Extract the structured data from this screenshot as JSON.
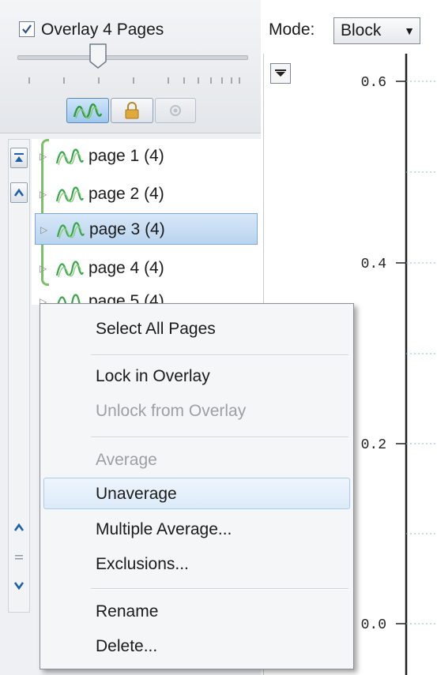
{
  "overlay": {
    "label": "Overlay 4 Pages",
    "checked": true
  },
  "toolbar": {
    "icons": [
      "wave-icon",
      "lock-icon",
      "circle-icon"
    ]
  },
  "mode": {
    "label": "Mode:",
    "value": "Block"
  },
  "pages": [
    {
      "label": "page 1 (4)",
      "selected": false
    },
    {
      "label": "page 2 (4)",
      "selected": false
    },
    {
      "label": "page 3 (4)",
      "selected": true
    },
    {
      "label": "page 4 (4)",
      "selected": false
    },
    {
      "label": "page 5 (4)",
      "selected": false
    }
  ],
  "context_menu": {
    "select_all": "Select All Pages",
    "lock_in_overlay": "Lock in Overlay",
    "unlock_from_overlay": "Unlock from Overlay",
    "average": "Average",
    "unaverage": "Unaverage",
    "multiple_average": "Multiple Average...",
    "exclusions": "Exclusions...",
    "rename": "Rename",
    "delete": "Delete..."
  },
  "chart": {
    "y_ticks": [
      "0.6",
      "0.4",
      "0.2",
      "0.0"
    ]
  },
  "colors": {
    "accent_green": "#7dc06a",
    "selection_blue": "#b9d4ef",
    "highlight_blue": "#dcebfa"
  }
}
